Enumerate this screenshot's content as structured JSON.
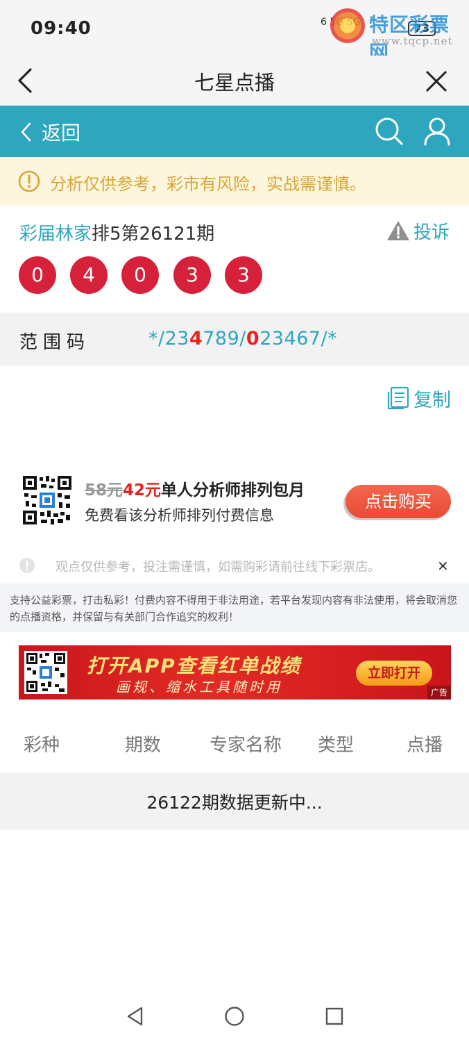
{
  "status_bar": {
    "time": "09:40",
    "signal_text": "6 5G 5G",
    "battery": "73"
  },
  "watermark": {
    "title": "特区彩票网",
    "url": "www.tqcp.net"
  },
  "header": {
    "title": "七星点播"
  },
  "nav": {
    "back_label": "返回"
  },
  "notice": {
    "text": "分析仅供参考，彩市有风险，实战需谨慎。"
  },
  "issue": {
    "author": "彩届林家",
    "title": "排5第26121期",
    "complaint_label": "投诉"
  },
  "balls": [
    "0",
    "4",
    "0",
    "3",
    "3"
  ],
  "range": {
    "label": "范围码",
    "code_parts": [
      "*/23",
      "4",
      "789/",
      "0",
      "23467/*"
    ]
  },
  "copy_label": "复制",
  "subscription": {
    "old_price": "58元",
    "new_price": "42元",
    "title": "单人分析师排列包月",
    "desc": "免费看该分析师排列付费信息",
    "buy_label": "点击购买"
  },
  "disclaimer": {
    "text": "观点仅供参考，投注需谨慎，如需购彩请前往线下彩票店。",
    "close": "×"
  },
  "legal": {
    "text": "支持公益彩票，打击私彩！付费内容不得用于非法用途，若平台发现内容有非法使用，将会取消您的点播资格，并保留与有关部门合作追究的权利！"
  },
  "banner": {
    "line1": "打开APP查看红单战绩",
    "line2": "画规、缩水工具随时用",
    "button": "立即打开",
    "ad_tag": "广告"
  },
  "table": {
    "headers": [
      "彩种",
      "期数",
      "专家名称",
      "类型",
      "点播"
    ],
    "status": "26122期数据更新中..."
  },
  "colors": {
    "teal": "#2ea6bd",
    "ball_red": "#d7203a",
    "highlight_red": "#e0261e",
    "notice_bg": "#fdf6dc",
    "notice_text": "#d9a53a"
  }
}
